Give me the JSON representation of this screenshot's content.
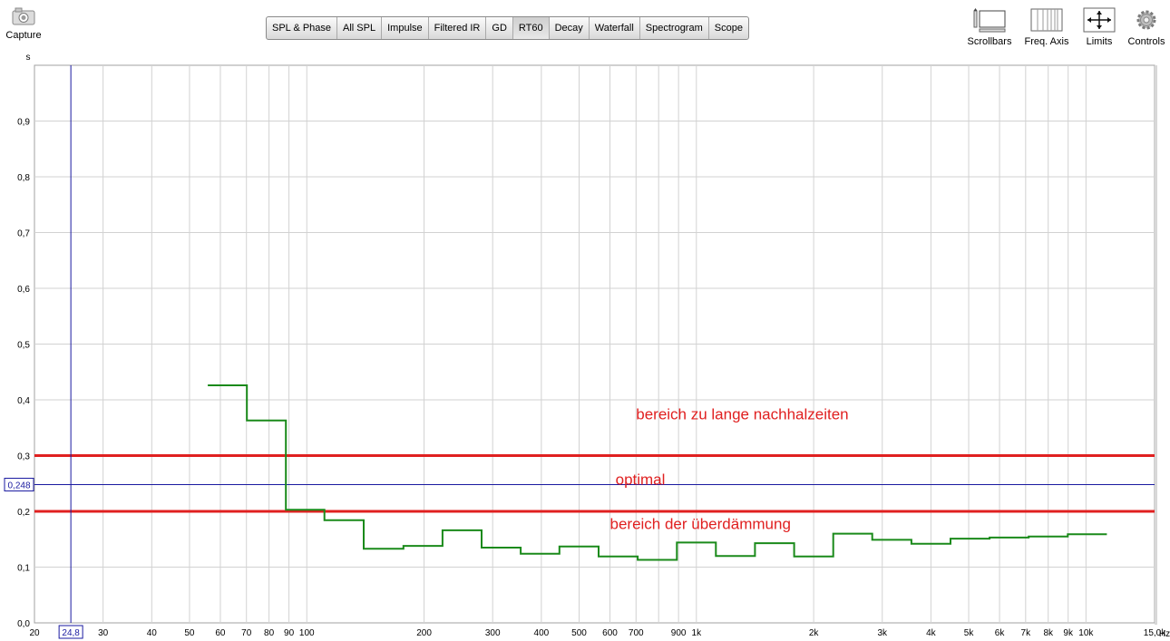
{
  "toolbar": {
    "capture_label": "Capture",
    "tabs": [
      {
        "label": "SPL & Phase"
      },
      {
        "label": "All SPL"
      },
      {
        "label": "Impulse"
      },
      {
        "label": "Filtered IR"
      },
      {
        "label": "GD"
      },
      {
        "label": "RT60",
        "active": true
      },
      {
        "label": "Decay"
      },
      {
        "label": "Waterfall"
      },
      {
        "label": "Spectrogram"
      },
      {
        "label": "Scope"
      }
    ],
    "scrollbars_label": "Scrollbars",
    "freq_axis_label": "Freq. Axis",
    "limits_label": "Limits",
    "controls_label": "Controls"
  },
  "chart_data": {
    "type": "line",
    "title": "",
    "xlabel": "Hz",
    "ylabel": "s",
    "xscale": "log",
    "xlim": [
      20,
      15000
    ],
    "ylim": [
      0,
      1.0
    ],
    "x_tick_labels": [
      {
        "v": 20,
        "t": "20"
      },
      {
        "v": 30,
        "t": "30"
      },
      {
        "v": 40,
        "t": "40"
      },
      {
        "v": 50,
        "t": "50"
      },
      {
        "v": 60,
        "t": "60"
      },
      {
        "v": 70,
        "t": "70"
      },
      {
        "v": 80,
        "t": "80"
      },
      {
        "v": 90,
        "t": "90"
      },
      {
        "v": 100,
        "t": "100"
      },
      {
        "v": 200,
        "t": "200"
      },
      {
        "v": 300,
        "t": "300"
      },
      {
        "v": 400,
        "t": "400"
      },
      {
        "v": 500,
        "t": "500"
      },
      {
        "v": 600,
        "t": "600"
      },
      {
        "v": 700,
        "t": "700"
      },
      {
        "v": 900,
        "t": "900"
      },
      {
        "v": 1000,
        "t": "1k"
      },
      {
        "v": 2000,
        "t": "2k"
      },
      {
        "v": 3000,
        "t": "3k"
      },
      {
        "v": 4000,
        "t": "4k"
      },
      {
        "v": 5000,
        "t": "5k"
      },
      {
        "v": 6000,
        "t": "6k"
      },
      {
        "v": 7000,
        "t": "7k"
      },
      {
        "v": 8000,
        "t": "8k"
      },
      {
        "v": 9000,
        "t": "9k"
      },
      {
        "v": 10000,
        "t": "10k"
      },
      {
        "v": 15000,
        "t": "15,0k"
      }
    ],
    "y_tick_labels": [
      {
        "v": 0.0,
        "t": "0,0"
      },
      {
        "v": 0.1,
        "t": "0,1"
      },
      {
        "v": 0.2,
        "t": "0,2"
      },
      {
        "v": 0.3,
        "t": "0,3"
      },
      {
        "v": 0.4,
        "t": "0,4"
      },
      {
        "v": 0.5,
        "t": "0,5"
      },
      {
        "v": 0.6,
        "t": "0,6"
      },
      {
        "v": 0.7,
        "t": "0,7"
      },
      {
        "v": 0.8,
        "t": "0,8"
      },
      {
        "v": 0.9,
        "t": "0,9"
      }
    ],
    "series": [
      {
        "color": "#1a8a1a",
        "bands": [
          [
            55.7,
            70.2,
            0.426
          ],
          [
            70.2,
            88.4,
            0.363
          ],
          [
            88.4,
            111,
            0.203
          ],
          [
            111,
            140,
            0.184
          ],
          [
            140,
            177,
            0.133
          ],
          [
            177,
            223,
            0.138
          ],
          [
            223,
            281,
            0.166
          ],
          [
            281,
            354,
            0.135
          ],
          [
            354,
            445,
            0.124
          ],
          [
            445,
            561,
            0.137
          ],
          [
            561,
            707,
            0.119
          ],
          [
            707,
            891,
            0.113
          ],
          [
            891,
            1122,
            0.144
          ],
          [
            1122,
            1414,
            0.12
          ],
          [
            1414,
            1782,
            0.143
          ],
          [
            1782,
            2245,
            0.119
          ],
          [
            2245,
            2828,
            0.16
          ],
          [
            2828,
            3564,
            0.149
          ],
          [
            3564,
            4490,
            0.142
          ],
          [
            4490,
            5657,
            0.151
          ],
          [
            5657,
            7127,
            0.153
          ],
          [
            7127,
            8980,
            0.155
          ],
          [
            8980,
            11314,
            0.159
          ]
        ]
      }
    ],
    "reference_lines": [
      {
        "y": 0.3,
        "color": "#e02020"
      },
      {
        "y": 0.2,
        "color": "#e02020"
      }
    ],
    "cursor": {
      "x": 24.8,
      "y": 0.248,
      "x_label": "24,8",
      "y_label": "0,248",
      "color": "#1a1aa0"
    },
    "annotations": [
      {
        "text": "bereich zu lange nachhalzeiten",
        "x": 700,
        "y": 0.365
      },
      {
        "text": "optimal",
        "x": 620,
        "y": 0.248
      },
      {
        "text": "bereich der überdämmung",
        "x": 600,
        "y": 0.168
      }
    ],
    "annotation_color": "#e02020",
    "grid": true
  }
}
